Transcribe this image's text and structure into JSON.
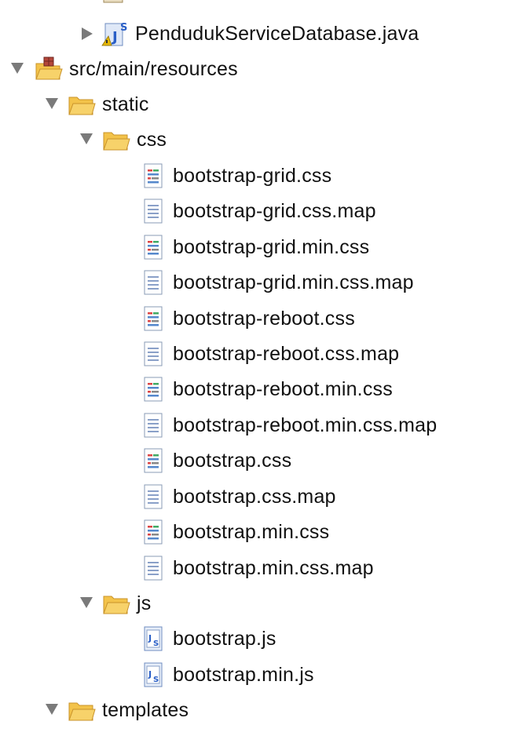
{
  "tree": {
    "items": [
      {
        "label": "PendudukServiceDatabase.java",
        "icon": "java-interface-icon",
        "expanded": false
      },
      {
        "label": "src/main/resources",
        "icon": "source-folder-icon",
        "expanded": true
      },
      {
        "label": "static",
        "icon": "folder-icon",
        "expanded": true
      },
      {
        "label": "css",
        "icon": "folder-icon",
        "expanded": true
      },
      {
        "label": "bootstrap-grid.css",
        "icon": "css-file-icon"
      },
      {
        "label": "bootstrap-grid.css.map",
        "icon": "text-file-icon"
      },
      {
        "label": "bootstrap-grid.min.css",
        "icon": "css-file-icon"
      },
      {
        "label": "bootstrap-grid.min.css.map",
        "icon": "text-file-icon"
      },
      {
        "label": "bootstrap-reboot.css",
        "icon": "css-file-icon"
      },
      {
        "label": "bootstrap-reboot.css.map",
        "icon": "text-file-icon"
      },
      {
        "label": "bootstrap-reboot.min.css",
        "icon": "css-file-icon"
      },
      {
        "label": "bootstrap-reboot.min.css.map",
        "icon": "text-file-icon"
      },
      {
        "label": "bootstrap.css",
        "icon": "css-file-icon"
      },
      {
        "label": "bootstrap.css.map",
        "icon": "text-file-icon"
      },
      {
        "label": "bootstrap.min.css",
        "icon": "css-file-icon"
      },
      {
        "label": "bootstrap.min.css.map",
        "icon": "text-file-icon"
      },
      {
        "label": "js",
        "icon": "folder-icon",
        "expanded": true
      },
      {
        "label": "bootstrap.js",
        "icon": "js-file-icon"
      },
      {
        "label": "bootstrap.min.js",
        "icon": "js-file-icon"
      },
      {
        "label": "templates",
        "icon": "folder-icon",
        "expanded": true
      }
    ]
  },
  "colors": {
    "folder": "#f3c34a",
    "folder_edge": "#c9932a",
    "twisty": "#7a7a7a",
    "java_blue": "#2a5fc7",
    "file_edge": "#8a9bb5"
  }
}
